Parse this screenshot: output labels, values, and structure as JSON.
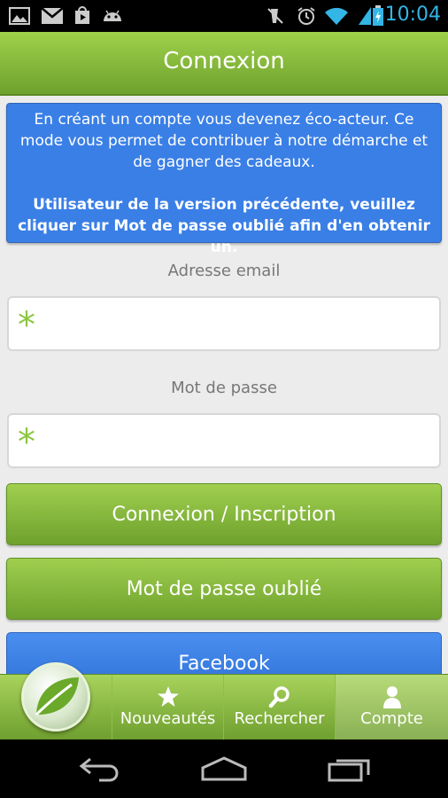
{
  "status_bar": {
    "time": "10:04",
    "icons": [
      "gallery-icon",
      "gmail-icon",
      "play-store-icon",
      "android-icon",
      "mute-icon",
      "alarm-icon",
      "wifi-icon",
      "battery-icon"
    ]
  },
  "header": {
    "title": "Connexion"
  },
  "info": {
    "paragraph1": "En créant un compte vous devenez éco-acteur. Ce mode vous permet de contribuer à notre démarche et de gagner des cadeaux.",
    "paragraph2": "Utilisateur de la version précédente, veuillez cliquer sur Mot de passe oublié afin d'en obtenir un."
  },
  "form": {
    "email_label": "Adresse email",
    "email_required": "*",
    "password_label": "Mot de passe",
    "password_required": "*"
  },
  "buttons": {
    "login": "Connexion / Inscription",
    "forgot": "Mot de passe oublié",
    "facebook": "Facebook"
  },
  "tabs": [
    {
      "label": "Nouveautés",
      "icon": "star-icon"
    },
    {
      "label": "Rechercher",
      "icon": "search-icon"
    },
    {
      "label": "Compte",
      "icon": "user-icon",
      "active": true
    }
  ],
  "colors": {
    "accent_green": "#8cc63f",
    "header_green": "#6ea12d",
    "info_blue": "#3a7fe6",
    "time_blue": "#33b5e5"
  }
}
